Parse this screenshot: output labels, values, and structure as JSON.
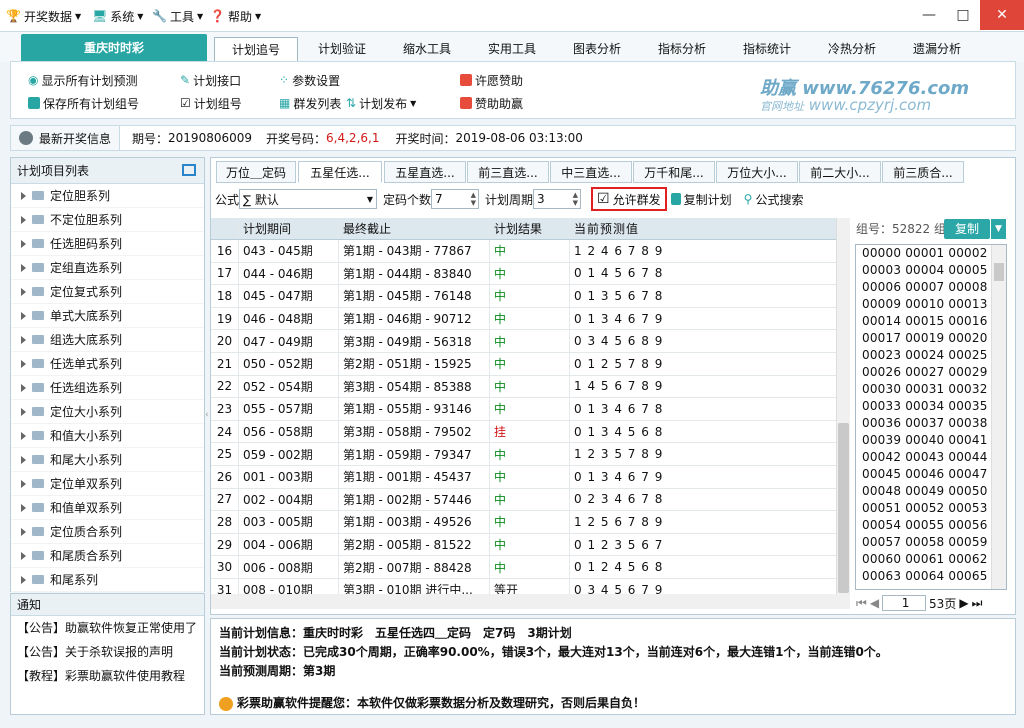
{
  "menu": [
    {
      "label": "开奖数据",
      "icon": "trophy-icon"
    },
    {
      "label": "系统",
      "icon": "monitor-icon"
    },
    {
      "label": "工具",
      "icon": "wrench-icon"
    },
    {
      "label": "帮助",
      "icon": "help-icon"
    }
  ],
  "window": {
    "minimize": "—",
    "maximize": "□",
    "close": "✕"
  },
  "lottery_tab": "重庆时时彩",
  "nav_tabs": [
    "计划追号",
    "计划验证",
    "缩水工具",
    "实用工具",
    "图表分析",
    "指标分析",
    "指标统计",
    "冷热分析",
    "遗漏分析"
  ],
  "ribbon": {
    "show_all": "显示所有计划预测",
    "save_all": "保存所有计划组号",
    "plan_api": "计划接口",
    "plan_group": "计划组号",
    "params": "参数设置",
    "group_list": "群发列表",
    "plan_publish": "计划发布",
    "wish": "许愿赞助",
    "sponsor": "赞助助赢",
    "brand": "助赢",
    "brand_url": "www.76276.com",
    "brand_sub": "官网地址",
    "brand_url2": "www.cpzyrj.com"
  },
  "infobar": {
    "label": "最新开奖信息",
    "period_label": "期号：",
    "period": "20190806009",
    "code_label": "开奖号码：",
    "code": "6,4,2,6,1",
    "time_label": "开奖时间：",
    "time": "2019-08-06 03:13:00"
  },
  "left": {
    "header": "计划项目列表",
    "items": [
      "定位胆系列",
      "不定位胆系列",
      "任选胆码系列",
      "定组直选系列",
      "定位复式系列",
      "单式大底系列",
      "组选大底系列",
      "任选单式系列",
      "任选组选系列",
      "定位大小系列",
      "和值大小系列",
      "和尾大小系列",
      "定位单双系列",
      "和值单双系列",
      "定位质合系列",
      "和尾质合系列",
      "和尾系列"
    ]
  },
  "notice": {
    "header": "通知",
    "items": [
      "【公告】助赢软件恢复正常使用了",
      "【公告】关于杀软误报的声明",
      "【教程】彩票助赢软件使用教程"
    ]
  },
  "sub_tabs": [
    "万位＿定码",
    "五星任选...",
    "五星直选...",
    "前三直选...",
    "中三直选...",
    "万千和尾...",
    "万位大小...",
    "前二大小...",
    "前三质合..."
  ],
  "toolbar": {
    "formula_label": "公式",
    "formula_value": "∑ 默认",
    "count_label": "定码个数",
    "count": "7",
    "cycle_label": "计划周期",
    "cycle": "3",
    "allow_group": "允许群发",
    "copy_plan": "复制计划",
    "formula_search": "公式搜索"
  },
  "table": {
    "headers": [
      "",
      "计划期间",
      "最终截止",
      "计划结果",
      "当前预测值"
    ],
    "rows": [
      [
        "16",
        "043 - 045期",
        "第1期 - 043期 - 77867",
        "中",
        "1 2 4 6 7 8 9"
      ],
      [
        "17",
        "044 - 046期",
        "第1期 - 044期 - 83840",
        "中",
        "0 1 4 5 6 7 8"
      ],
      [
        "18",
        "045 - 047期",
        "第1期 - 045期 - 76148",
        "中",
        "0 1 3 5 6 7 8"
      ],
      [
        "19",
        "046 - 048期",
        "第1期 - 046期 - 90712",
        "中",
        "0 1 3 4 6 7 9"
      ],
      [
        "20",
        "047 - 049期",
        "第3期 - 049期 - 56318",
        "中",
        "0 3 4 5 6 8 9"
      ],
      [
        "21",
        "050 - 052期",
        "第2期 - 051期 - 15925",
        "中",
        "0 1 2 5 7 8 9"
      ],
      [
        "22",
        "052 - 054期",
        "第3期 - 054期 - 85388",
        "中",
        "1 4 5 6 7 8 9"
      ],
      [
        "23",
        "055 - 057期",
        "第1期 - 055期 - 93146",
        "中",
        "0 1 3 4 6 7 8"
      ],
      [
        "24",
        "056 - 058期",
        "第3期 - 058期 - 79502",
        "挂",
        "0 1 3 4 5 6 8"
      ],
      [
        "25",
        "059 - 002期",
        "第1期 - 059期 - 79347",
        "中",
        "1 2 3 5 7 8 9"
      ],
      [
        "26",
        "001 - 003期",
        "第1期 - 001期 - 45437",
        "中",
        "0 1 3 4 6 7 9"
      ],
      [
        "27",
        "002 - 004期",
        "第1期 - 002期 - 57446",
        "中",
        "0 2 3 4 6 7 8"
      ],
      [
        "28",
        "003 - 005期",
        "第1期 - 003期 - 49526",
        "中",
        "1 2 5 6 7 8 9"
      ],
      [
        "29",
        "004 - 006期",
        "第2期 - 005期 - 81522",
        "中",
        "0 1 2 3 5 6 7"
      ],
      [
        "30",
        "006 - 008期",
        "第2期 - 007期 - 88428",
        "中",
        "0 1 2 4 5 6 8"
      ],
      [
        "31",
        "008 - 010期",
        "第3期 - 010期 进行中...",
        "等开",
        "0 3 4 5 6 7 9"
      ]
    ]
  },
  "right": {
    "group_label": "组号：52822 组",
    "copy": "复制",
    "combos": [
      "00000 00001 00002",
      "00003 00004 00005",
      "00006 00007 00008",
      "00009 00010 00013",
      "00014 00015 00016",
      "00017 00019 00020",
      "00023 00024 00025",
      "00026 00027 00029",
      "00030 00031 00032",
      "00033 00034 00035",
      "00036 00037 00038",
      "00039 00040 00041",
      "00042 00043 00044",
      "00045 00046 00047",
      "00048 00049 00050",
      "00051 00052 00053",
      "00054 00055 00056",
      "00057 00058 00059",
      "00060 00061 00062",
      "00063 00064 00065"
    ]
  },
  "pager": {
    "page": "1",
    "total": "53页"
  },
  "status": {
    "l1_label": "当前计划信息：",
    "l1": "重庆时时彩　五星任选四＿定码　定7码　3期计划",
    "l2_label": "当前计划状态：",
    "l2": "已完成30个周期，正确率90.00%，错误3个，最大连对13个，当前连对6个，最大连错1个，当前连错0个。",
    "l3_label": "当前预测周期：",
    "l3": "第3期",
    "warn": "彩票助赢软件提醒您：本软件仅做彩票数据分析及数理研究，否则后果自负！"
  },
  "colors": {
    "accent": "#27a6a4",
    "hit": "#0a8a1e",
    "miss": "#d21a1a",
    "code": "#d21a1a",
    "highlight_box": "#e02020"
  }
}
